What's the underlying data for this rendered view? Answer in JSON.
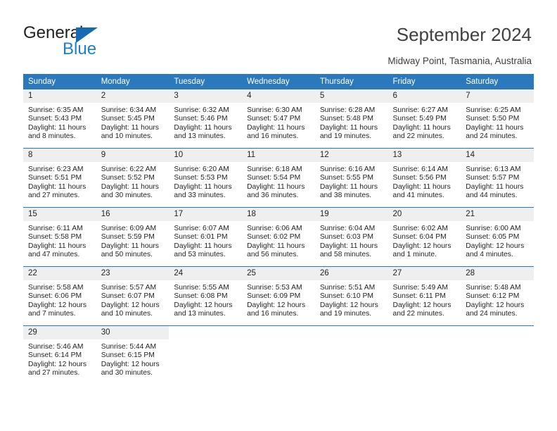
{
  "brand": {
    "name_top": "General",
    "name_bottom": "Blue",
    "accent_color": "#1669b2",
    "text_color": "#231f20"
  },
  "header": {
    "title": "September 2024",
    "subtitle": "Midway Point, Tasmania, Australia"
  },
  "calendar": {
    "header_bg": "#2b79bd",
    "daynum_bg": "#efefef",
    "weekday_headers": [
      "Sunday",
      "Monday",
      "Tuesday",
      "Wednesday",
      "Thursday",
      "Friday",
      "Saturday"
    ],
    "weeks": [
      [
        {
          "day": "1",
          "sunrise": "Sunrise: 6:35 AM",
          "sunset": "Sunset: 5:43 PM",
          "daylight_line1": "Daylight: 11 hours",
          "daylight_line2": "and 8 minutes."
        },
        {
          "day": "2",
          "sunrise": "Sunrise: 6:34 AM",
          "sunset": "Sunset: 5:45 PM",
          "daylight_line1": "Daylight: 11 hours",
          "daylight_line2": "and 10 minutes."
        },
        {
          "day": "3",
          "sunrise": "Sunrise: 6:32 AM",
          "sunset": "Sunset: 5:46 PM",
          "daylight_line1": "Daylight: 11 hours",
          "daylight_line2": "and 13 minutes."
        },
        {
          "day": "4",
          "sunrise": "Sunrise: 6:30 AM",
          "sunset": "Sunset: 5:47 PM",
          "daylight_line1": "Daylight: 11 hours",
          "daylight_line2": "and 16 minutes."
        },
        {
          "day": "5",
          "sunrise": "Sunrise: 6:28 AM",
          "sunset": "Sunset: 5:48 PM",
          "daylight_line1": "Daylight: 11 hours",
          "daylight_line2": "and 19 minutes."
        },
        {
          "day": "6",
          "sunrise": "Sunrise: 6:27 AM",
          "sunset": "Sunset: 5:49 PM",
          "daylight_line1": "Daylight: 11 hours",
          "daylight_line2": "and 22 minutes."
        },
        {
          "day": "7",
          "sunrise": "Sunrise: 6:25 AM",
          "sunset": "Sunset: 5:50 PM",
          "daylight_line1": "Daylight: 11 hours",
          "daylight_line2": "and 24 minutes."
        }
      ],
      [
        {
          "day": "8",
          "sunrise": "Sunrise: 6:23 AM",
          "sunset": "Sunset: 5:51 PM",
          "daylight_line1": "Daylight: 11 hours",
          "daylight_line2": "and 27 minutes."
        },
        {
          "day": "9",
          "sunrise": "Sunrise: 6:22 AM",
          "sunset": "Sunset: 5:52 PM",
          "daylight_line1": "Daylight: 11 hours",
          "daylight_line2": "and 30 minutes."
        },
        {
          "day": "10",
          "sunrise": "Sunrise: 6:20 AM",
          "sunset": "Sunset: 5:53 PM",
          "daylight_line1": "Daylight: 11 hours",
          "daylight_line2": "and 33 minutes."
        },
        {
          "day": "11",
          "sunrise": "Sunrise: 6:18 AM",
          "sunset": "Sunset: 5:54 PM",
          "daylight_line1": "Daylight: 11 hours",
          "daylight_line2": "and 36 minutes."
        },
        {
          "day": "12",
          "sunrise": "Sunrise: 6:16 AM",
          "sunset": "Sunset: 5:55 PM",
          "daylight_line1": "Daylight: 11 hours",
          "daylight_line2": "and 38 minutes."
        },
        {
          "day": "13",
          "sunrise": "Sunrise: 6:14 AM",
          "sunset": "Sunset: 5:56 PM",
          "daylight_line1": "Daylight: 11 hours",
          "daylight_line2": "and 41 minutes."
        },
        {
          "day": "14",
          "sunrise": "Sunrise: 6:13 AM",
          "sunset": "Sunset: 5:57 PM",
          "daylight_line1": "Daylight: 11 hours",
          "daylight_line2": "and 44 minutes."
        }
      ],
      [
        {
          "day": "15",
          "sunrise": "Sunrise: 6:11 AM",
          "sunset": "Sunset: 5:58 PM",
          "daylight_line1": "Daylight: 11 hours",
          "daylight_line2": "and 47 minutes."
        },
        {
          "day": "16",
          "sunrise": "Sunrise: 6:09 AM",
          "sunset": "Sunset: 5:59 PM",
          "daylight_line1": "Daylight: 11 hours",
          "daylight_line2": "and 50 minutes."
        },
        {
          "day": "17",
          "sunrise": "Sunrise: 6:07 AM",
          "sunset": "Sunset: 6:01 PM",
          "daylight_line1": "Daylight: 11 hours",
          "daylight_line2": "and 53 minutes."
        },
        {
          "day": "18",
          "sunrise": "Sunrise: 6:06 AM",
          "sunset": "Sunset: 6:02 PM",
          "daylight_line1": "Daylight: 11 hours",
          "daylight_line2": "and 56 minutes."
        },
        {
          "day": "19",
          "sunrise": "Sunrise: 6:04 AM",
          "sunset": "Sunset: 6:03 PM",
          "daylight_line1": "Daylight: 11 hours",
          "daylight_line2": "and 58 minutes."
        },
        {
          "day": "20",
          "sunrise": "Sunrise: 6:02 AM",
          "sunset": "Sunset: 6:04 PM",
          "daylight_line1": "Daylight: 12 hours",
          "daylight_line2": "and 1 minute."
        },
        {
          "day": "21",
          "sunrise": "Sunrise: 6:00 AM",
          "sunset": "Sunset: 6:05 PM",
          "daylight_line1": "Daylight: 12 hours",
          "daylight_line2": "and 4 minutes."
        }
      ],
      [
        {
          "day": "22",
          "sunrise": "Sunrise: 5:58 AM",
          "sunset": "Sunset: 6:06 PM",
          "daylight_line1": "Daylight: 12 hours",
          "daylight_line2": "and 7 minutes."
        },
        {
          "day": "23",
          "sunrise": "Sunrise: 5:57 AM",
          "sunset": "Sunset: 6:07 PM",
          "daylight_line1": "Daylight: 12 hours",
          "daylight_line2": "and 10 minutes."
        },
        {
          "day": "24",
          "sunrise": "Sunrise: 5:55 AM",
          "sunset": "Sunset: 6:08 PM",
          "daylight_line1": "Daylight: 12 hours",
          "daylight_line2": "and 13 minutes."
        },
        {
          "day": "25",
          "sunrise": "Sunrise: 5:53 AM",
          "sunset": "Sunset: 6:09 PM",
          "daylight_line1": "Daylight: 12 hours",
          "daylight_line2": "and 16 minutes."
        },
        {
          "day": "26",
          "sunrise": "Sunrise: 5:51 AM",
          "sunset": "Sunset: 6:10 PM",
          "daylight_line1": "Daylight: 12 hours",
          "daylight_line2": "and 19 minutes."
        },
        {
          "day": "27",
          "sunrise": "Sunrise: 5:49 AM",
          "sunset": "Sunset: 6:11 PM",
          "daylight_line1": "Daylight: 12 hours",
          "daylight_line2": "and 22 minutes."
        },
        {
          "day": "28",
          "sunrise": "Sunrise: 5:48 AM",
          "sunset": "Sunset: 6:12 PM",
          "daylight_line1": "Daylight: 12 hours",
          "daylight_line2": "and 24 minutes."
        }
      ],
      [
        {
          "day": "29",
          "sunrise": "Sunrise: 5:46 AM",
          "sunset": "Sunset: 6:14 PM",
          "daylight_line1": "Daylight: 12 hours",
          "daylight_line2": "and 27 minutes."
        },
        {
          "day": "30",
          "sunrise": "Sunrise: 5:44 AM",
          "sunset": "Sunset: 6:15 PM",
          "daylight_line1": "Daylight: 12 hours",
          "daylight_line2": "and 30 minutes."
        },
        {
          "day": "",
          "sunrise": "",
          "sunset": "",
          "daylight_line1": "",
          "daylight_line2": ""
        },
        {
          "day": "",
          "sunrise": "",
          "sunset": "",
          "daylight_line1": "",
          "daylight_line2": ""
        },
        {
          "day": "",
          "sunrise": "",
          "sunset": "",
          "daylight_line1": "",
          "daylight_line2": ""
        },
        {
          "day": "",
          "sunrise": "",
          "sunset": "",
          "daylight_line1": "",
          "daylight_line2": ""
        },
        {
          "day": "",
          "sunrise": "",
          "sunset": "",
          "daylight_line1": "",
          "daylight_line2": ""
        }
      ]
    ]
  }
}
